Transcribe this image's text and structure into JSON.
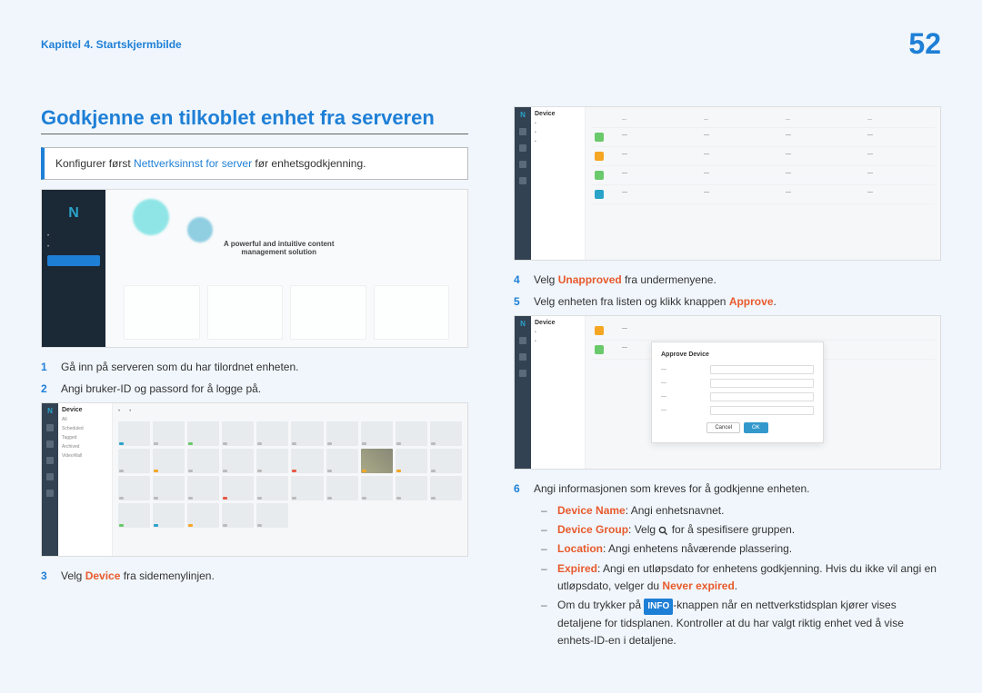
{
  "header": {
    "chapter": "Kapittel 4. Startskjermbilde",
    "page": "52"
  },
  "section_title": "Godkjenne en tilkoblet enhet fra serveren",
  "info_box": {
    "pre": "Konfigurer først ",
    "link": "Nettverksinnst for server",
    "post": " før enhetsgodkjenning."
  },
  "login_tagline": {
    "line1": "A powerful and intuitive content",
    "line2": "management solution"
  },
  "steps_left": {
    "s1": {
      "num": "1",
      "text": "Gå inn på serveren som du har tilordnet enheten."
    },
    "s2": {
      "num": "2",
      "text": "Angi bruker-ID og passord for å logge på."
    },
    "s3": {
      "num": "3",
      "pre": "Velg ",
      "red": "Device",
      "post": " fra sidemenylinjen."
    }
  },
  "device_panel": {
    "title": "Device",
    "items": [
      "All",
      "Scheduled",
      "Tagged",
      "Archived",
      "VideoWall"
    ]
  },
  "steps_right": {
    "s4": {
      "num": "4",
      "pre": "Velg ",
      "red": "Unapproved",
      "post": " fra undermenyene."
    },
    "s5": {
      "num": "5",
      "pre": "Velg enheten fra listen og klikk knappen ",
      "red": "Approve",
      "post": "."
    },
    "s6": {
      "num": "6",
      "text": "Angi informasjonen som kreves for å godkjenne enheten."
    }
  },
  "modal": {
    "title": "Approve Device",
    "cancel": "Cancel",
    "ok": "OK"
  },
  "bullets": {
    "b1": {
      "red": "Device Name",
      "text": ": Angi enhetsnavnet."
    },
    "b2": {
      "red": "Device Group",
      "pre": ": Velg ",
      "post": " for å spesifisere gruppen."
    },
    "b3": {
      "red": "Location",
      "text": ": Angi enhetens nåværende plassering."
    },
    "b4": {
      "red": "Expired",
      "pre": ": Angi en utløpsdato for enhetens godkjenning. Hvis du ikke vil angi en utløpsdato, velger du ",
      "red2": "Never expired",
      "post": "."
    },
    "b5": {
      "pre": "Om du trykker på ",
      "badge": "INFO",
      "post": "-knappen når en nettverkstidsplan kjører vises detaljene for tidsplanen. Kontroller at du har valgt riktig enhet ved å vise enhets-ID-en i detaljene."
    }
  }
}
